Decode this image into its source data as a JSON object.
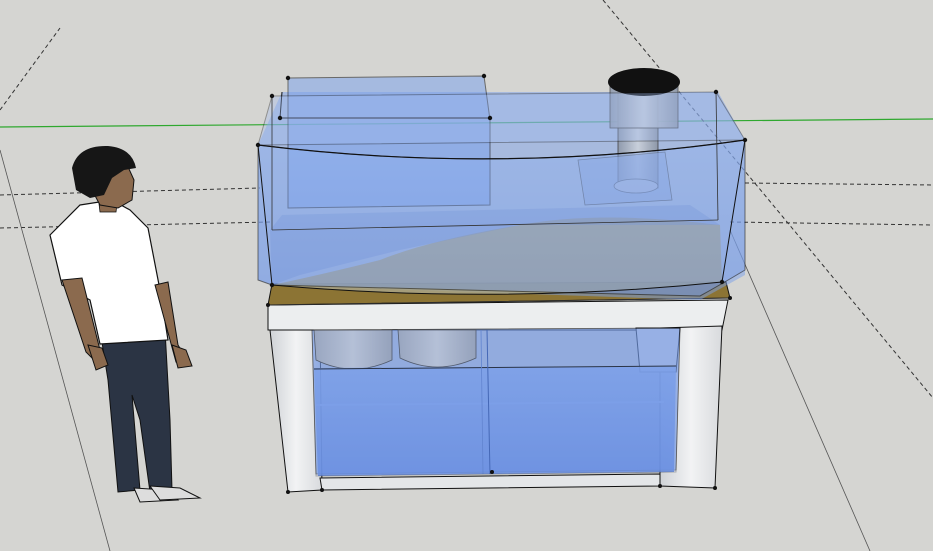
{
  "scene": {
    "description_free": true,
    "background_color": "#d5d5d2",
    "axis_colors": {
      "green": "#2fa82f",
      "dashed": "#222222"
    },
    "glass_color": "#6f95e6",
    "water_color": "#5d84db",
    "wood_color": "#8c7434",
    "stand_color": "#e6e8ea",
    "sand_color": "#b7ad8c",
    "figure": {
      "shirt": "#ffffff",
      "pants": "#2b3444",
      "skin": "#8b6a4e",
      "hair": "#161616"
    }
  }
}
